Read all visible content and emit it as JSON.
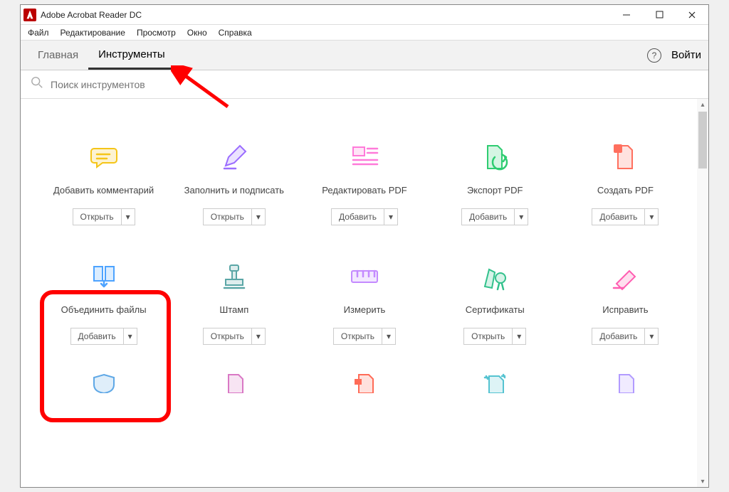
{
  "title": "Adobe Acrobat Reader DC",
  "menu": [
    "Файл",
    "Редактирование",
    "Просмотр",
    "Окно",
    "Справка"
  ],
  "tabs": {
    "home": "Главная",
    "tools": "Инструменты"
  },
  "signin": "Войти",
  "search": {
    "placeholder": "Поиск инструментов"
  },
  "btn": {
    "open": "Открыть",
    "add": "Добавить"
  },
  "tools": [
    {
      "name": "Добавить комментарий",
      "action": "open",
      "icon": "comment",
      "color": "#f5c518"
    },
    {
      "name": "Заполнить и подписать",
      "action": "open",
      "icon": "pen",
      "color": "#9b6dff"
    },
    {
      "name": "Редактировать PDF",
      "action": "add",
      "icon": "edit",
      "color": "#ff7ad9"
    },
    {
      "name": "Экспорт PDF",
      "action": "add",
      "icon": "export",
      "color": "#2ecc71"
    },
    {
      "name": "Создать PDF",
      "action": "add",
      "icon": "create",
      "color": "#ff6f5e"
    },
    {
      "name": "Объединить файлы",
      "action": "add",
      "icon": "combine",
      "color": "#4da3ff"
    },
    {
      "name": "Штамп",
      "action": "open",
      "icon": "stamp",
      "color": "#5aa6a6"
    },
    {
      "name": "Измерить",
      "action": "open",
      "icon": "measure",
      "color": "#c48aff"
    },
    {
      "name": "Сертификаты",
      "action": "open",
      "icon": "cert",
      "color": "#32c18c"
    },
    {
      "name": "Исправить",
      "action": "add",
      "icon": "redact",
      "color": "#ff5db1"
    }
  ],
  "peek": [
    {
      "icon": "shield",
      "color": "#5fa8e6"
    },
    {
      "icon": "page",
      "color": "#d978c5"
    },
    {
      "icon": "page2",
      "color": "#ff6b57"
    },
    {
      "icon": "sparkle",
      "color": "#55c3d1"
    },
    {
      "icon": "page3",
      "color": "#b29bff"
    }
  ]
}
